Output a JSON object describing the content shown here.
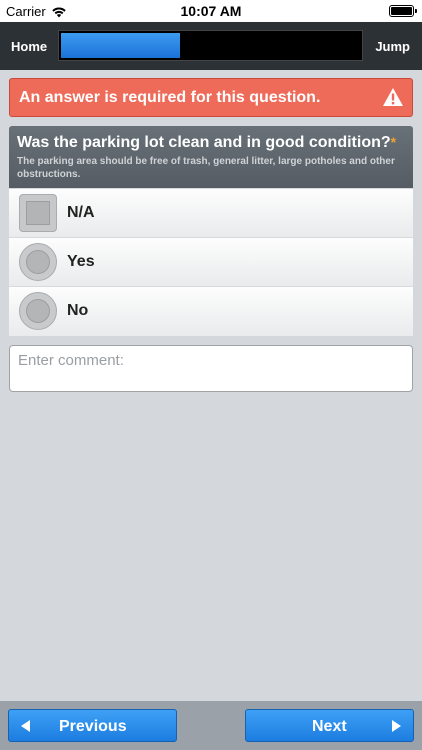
{
  "status_bar": {
    "carrier": "Carrier",
    "time": "10:07 AM",
    "wifi_icon": "wifi-icon",
    "battery_icon": "battery-icon"
  },
  "nav": {
    "home_label": "Home",
    "jump_label": "Jump",
    "progress_fraction": 0.4
  },
  "alert": {
    "message": "An answer is required for this question.",
    "icon": "warning-icon",
    "color": "#ee6b5a"
  },
  "question": {
    "title": "Was the parking lot clean and in good condition?",
    "required_marker": "*",
    "description": "The parking area should be free of trash, general litter, large potholes and other obstructions.",
    "options": [
      {
        "label": "N/A",
        "type": "checkbox"
      },
      {
        "label": "Yes",
        "type": "radio"
      },
      {
        "label": "No",
        "type": "radio"
      }
    ]
  },
  "comment": {
    "placeholder": "Enter comment:",
    "value": ""
  },
  "footer": {
    "previous_label": "Previous",
    "next_label": "Next",
    "accent_color": "#2a8ae8"
  }
}
